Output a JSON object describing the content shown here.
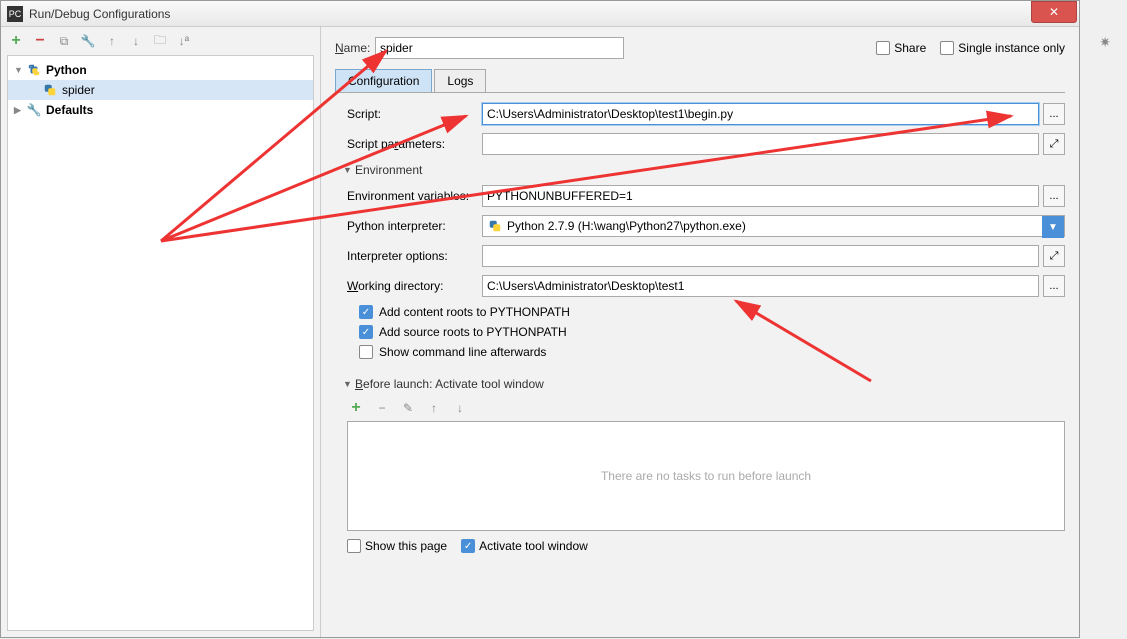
{
  "title": "Run/Debug Configurations",
  "close_x": "✕",
  "sidebar": {
    "toolbar": {
      "plus": "+",
      "minus": "−",
      "copy": "⧉",
      "wrench": "🔧",
      "up": "↑",
      "down": "↓",
      "folder": "🗀",
      "sort": "↓ª"
    },
    "items": [
      {
        "label": "Python",
        "bold": true,
        "arrow": true,
        "icon": "py"
      },
      {
        "label": "spider",
        "indent": true,
        "icon": "py",
        "sel": true
      },
      {
        "label": "Defaults",
        "bold": true,
        "arrow": true,
        "icon": "gear"
      }
    ]
  },
  "header": {
    "name_label": "Name:",
    "name_value": "spider",
    "share_label": "Share",
    "single_label": "Single instance only"
  },
  "tabs": {
    "config": "Configuration",
    "logs": "Logs"
  },
  "form": {
    "script_label": "Script:",
    "script_value": "C:\\Users\\Administrator\\Desktop\\test1\\begin.py",
    "params_label": "Script parameters:",
    "params_value": "",
    "env_header": "Environment",
    "envvars_label": "Environment variables:",
    "envvars_value": "PYTHONUNBUFFERED=1",
    "interp_label": "Python interpreter:",
    "interp_value": "Python 2.7.9 (H:\\wang\\Python27\\python.exe)",
    "interpopt_label": "Interpreter options:",
    "interpopt_value": "",
    "workdir_label": "Working directory:",
    "workdir_value": "C:\\Users\\Administrator\\Desktop\\test1",
    "chk_content": "Add content roots to PYTHONPATH",
    "chk_source": "Add source roots to PYTHONPATH",
    "chk_cmdline": "Show command line afterwards"
  },
  "before": {
    "header": "Before launch: Activate tool window",
    "empty_msg": "There are no tasks to run before launch",
    "tools": {
      "plus": "+",
      "minus": "−",
      "edit": "✎",
      "up": "↑",
      "down": "↓"
    }
  },
  "footer": {
    "show_page": "Show this page",
    "activate": "Activate tool window"
  },
  "browse": "...",
  "expand": "⤢"
}
